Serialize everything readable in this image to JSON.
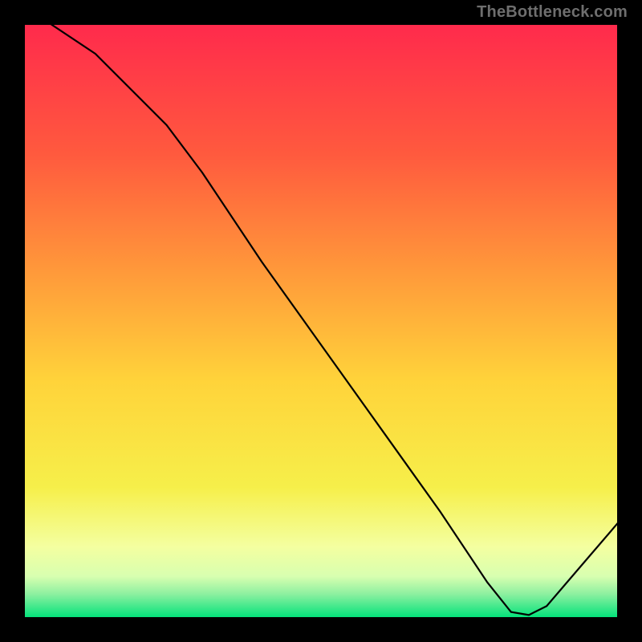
{
  "watermark": "TheBottleneck.com",
  "series_label": "",
  "chart_data": {
    "type": "line",
    "title": "",
    "xlabel": "",
    "ylabel": "",
    "xlim": [
      0,
      100
    ],
    "ylim": [
      0,
      100
    ],
    "grid": false,
    "legend_position": "near-minimum",
    "background_gradient": {
      "top": "#ff2a4c",
      "mid_upper": "#ff8a3a",
      "mid": "#ffd83a",
      "mid_lower": "#f6ff6a",
      "near_bottom": "#8effa0",
      "bottom": "#00e27a"
    },
    "curve_points": [
      {
        "x": 0,
        "y": 103
      },
      {
        "x": 12,
        "y": 95
      },
      {
        "x": 24,
        "y": 83
      },
      {
        "x": 30,
        "y": 75
      },
      {
        "x": 40,
        "y": 60
      },
      {
        "x": 50,
        "y": 46
      },
      {
        "x": 60,
        "y": 32
      },
      {
        "x": 70,
        "y": 18
      },
      {
        "x": 78,
        "y": 6
      },
      {
        "x": 82,
        "y": 1
      },
      {
        "x": 85,
        "y": 0.5
      },
      {
        "x": 88,
        "y": 2
      },
      {
        "x": 94,
        "y": 9
      },
      {
        "x": 100,
        "y": 16
      }
    ],
    "label_marker": {
      "x": 80.5,
      "y": 1.2
    }
  }
}
